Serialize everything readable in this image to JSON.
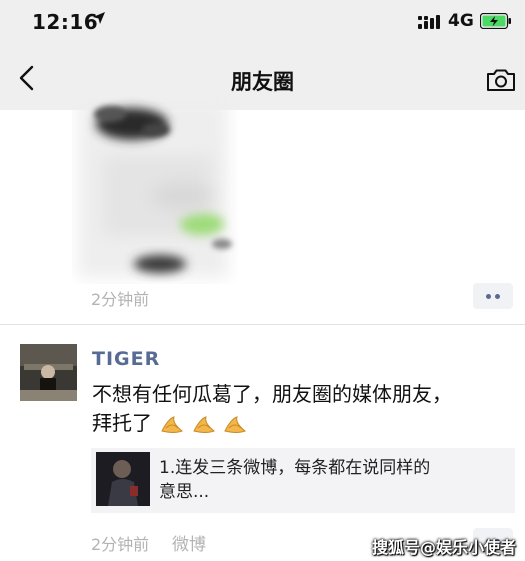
{
  "status_bar": {
    "time": "12:16",
    "location_icon": "location-arrow-icon",
    "signal_icon": "signal-bars-icon",
    "network": "4G",
    "battery_icon": "battery-charging-icon"
  },
  "nav": {
    "back_icon": "chevron-left-icon",
    "title": "朋友圈",
    "camera_icon": "camera-icon"
  },
  "first_post": {
    "image": "blurred-photo",
    "timestamp": "2分钟前",
    "more_icon": "more-dots-icon"
  },
  "second_post": {
    "username": "TIGER",
    "text_line1": "不想有任何瓜葛了，朋友圈的媒体朋友，",
    "text_line2": "拜托了",
    "emoji": "folded-hands-icon",
    "emoji_count": 3,
    "share_card": {
      "line1": "1.连发三条微博，每条都在说同样的",
      "line2": "意思..."
    },
    "timestamp": "2分钟前",
    "source": "微博"
  },
  "watermark": "搜狐号@娱乐小使者",
  "colors": {
    "bar_background": "#efefef",
    "username_blue": "#576b95",
    "timestamp_gray": "#b3b3b3",
    "share_card_bg": "#f3f3f5",
    "battery_green": "#4cd964"
  }
}
